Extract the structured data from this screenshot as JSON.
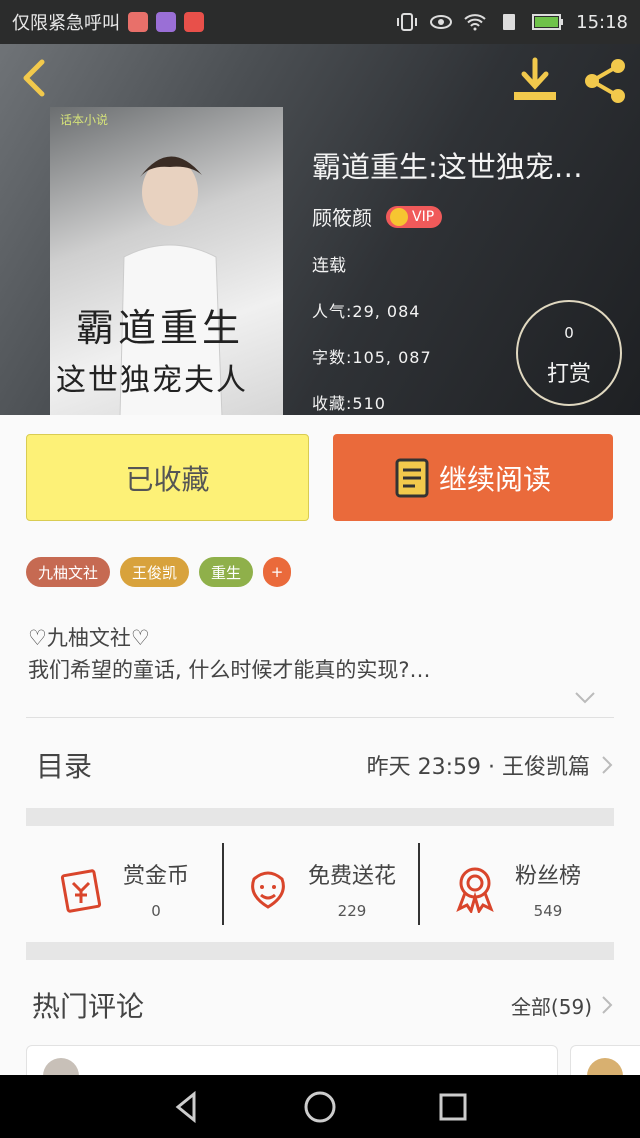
{
  "status_bar": {
    "carrier": "仅限紧急呼叫",
    "time": "15:18"
  },
  "book": {
    "title": "霸道重生:这世独宠…",
    "author": "顾筱颜",
    "vip_label": "VIP",
    "status": "连载",
    "popularity": "人气:29, 084",
    "word_count": "字数:105, 087",
    "favorites": "收藏:510",
    "cover": {
      "logo": "话本小说",
      "line1": "霸道重生",
      "line2": "这世独宠夫人"
    }
  },
  "tip": {
    "count": "0",
    "label": "打赏"
  },
  "actions": {
    "favorite_label": "已收藏",
    "read_label": "继续阅读"
  },
  "tags": [
    {
      "label": "九柚文社",
      "color": "#c66a52"
    },
    {
      "label": "王俊凯",
      "color": "#d8a23c"
    },
    {
      "label": "重生",
      "color": "#8fb04a"
    }
  ],
  "tag_add": "+",
  "description": {
    "line1": "♡九柚文社♡",
    "line2": "我们希望的童话, 什么时候才能真的实现?…"
  },
  "toc": {
    "label": "目录",
    "latest": "昨天 23:59 · 王俊凯篇"
  },
  "stats": [
    {
      "name": "赏金币",
      "value": "0",
      "icon": "red-envelope-icon"
    },
    {
      "name": "免费送花",
      "value": "229",
      "icon": "flower-icon"
    },
    {
      "name": "粉丝榜",
      "value": "549",
      "icon": "medal-icon"
    }
  ],
  "comments": {
    "label": "热门评论",
    "all": "全部(59)"
  },
  "colors": {
    "accent": "#ea6a3b",
    "favorite_bg": "#fdf177",
    "icon_gold": "#f2c94c"
  }
}
